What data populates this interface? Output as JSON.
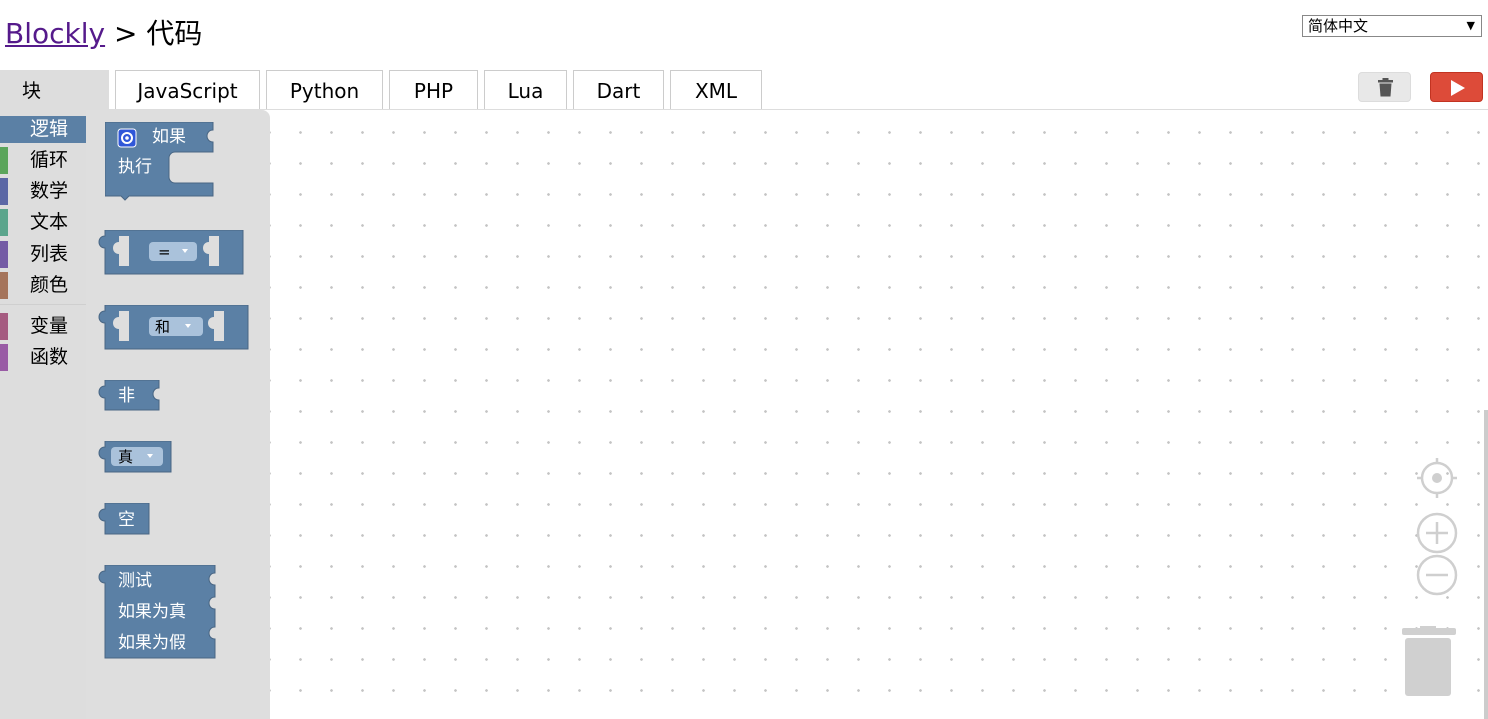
{
  "header": {
    "app_link": "Blockly",
    "separator": ">",
    "page_title": "代码",
    "language_select": "简体中文"
  },
  "tabs": {
    "blocks": "块",
    "items": [
      "JavaScript",
      "Python",
      "PHP",
      "Lua",
      "Dart",
      "XML"
    ]
  },
  "buttons": {
    "trash_icon": "trash-icon",
    "run_icon": "play-icon"
  },
  "toolbox": {
    "items": [
      {
        "label": "逻辑",
        "color": "#5b80a5",
        "selected": true
      },
      {
        "label": "循环",
        "color": "#5ba55b"
      },
      {
        "label": "数学",
        "color": "#5b67a5"
      },
      {
        "label": "文本",
        "color": "#5ba58c"
      },
      {
        "label": "列表",
        "color": "#745ba5"
      },
      {
        "label": "颜色",
        "color": "#a5745b"
      },
      {
        "label": "变量",
        "color": "#a55b80"
      },
      {
        "label": "函数",
        "color": "#995ba5"
      }
    ]
  },
  "flyout": {
    "block_color": "#5b80a5",
    "if_block": {
      "if_label": "如果",
      "do_label": "执行"
    },
    "compare_block": {
      "operator": "="
    },
    "operation_block": {
      "operator": "和"
    },
    "negate_block": {
      "label": "非"
    },
    "boolean_block": {
      "value": "真"
    },
    "null_block": {
      "label": "空"
    },
    "ternary_block": {
      "test_label": "测试",
      "then_label": "如果为真",
      "else_label": "如果为假"
    }
  },
  "workspace_controls": [
    "recenter-icon",
    "zoom-in-icon",
    "zoom-out-icon",
    "workspace-trash-icon"
  ]
}
